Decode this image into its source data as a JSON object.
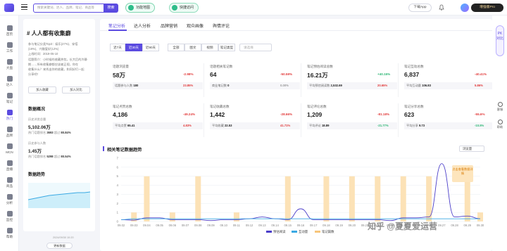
{
  "topbar": {
    "search_placeholder": "搜索关键词、达人、品牌、笔记、商品等",
    "search_button": "搜索",
    "pill1": "功能地图",
    "pill2": "快捷访问",
    "app_button": "下载App",
    "vip_label": "增强版Pro"
  },
  "sidenav": [
    {
      "label": "首页"
    },
    {
      "label": "工作"
    },
    {
      "label": "大盘"
    },
    {
      "label": "达人"
    },
    {
      "label": "笔记"
    },
    {
      "label": "热门"
    },
    {
      "label": "品牌"
    },
    {
      "label": "MCN"
    },
    {
      "label": "直播"
    },
    {
      "label": "商品"
    },
    {
      "label": "分析"
    },
    {
      "label": "监控"
    },
    {
      "label": "帮助"
    }
  ],
  "left": {
    "title": "# 人人都有收集癖",
    "meta1": "参与笔记分类Top3：娱乐(27%)、穿搭",
    "meta2": "(19%)、兴趣爱好(12%)",
    "meta3": "上线时间：2019-05-10",
    "meta4": "话题简介：小时候的收藏热忱，长大后的冷静",
    "meta5": "期……所有收集癖都应该被正视，你在",
    "meta6": "收集什么？来秀出你的收藏，和同好们一起",
    "meta7": "分享吧！",
    "btn1": "加入收藏",
    "btn2": "加入对比",
    "overview_h": "数据概况",
    "views_label": "历史浏览总量",
    "views_val": "5,102.06万",
    "views_rank_label": "热门话题排名",
    "views_rank": "3693",
    "views_beat_label": "超过",
    "views_beat": "80.84%",
    "part_label": "历史参与人数",
    "part_val": "1.45万",
    "part_rank_label": "热门话题排名",
    "part_rank": "5298",
    "part_beat_label": "超过",
    "part_beat": "80.54%",
    "trend_h": "数据趋势",
    "update_date": "2024/09/30 10:20",
    "update_btn": "更新数据"
  },
  "tabs": [
    "笔记分析",
    "达人分析",
    "品牌营销",
    "观众画像",
    "舆情评论"
  ],
  "ranges": [
    "近7天",
    "近30天",
    "近90天"
  ],
  "types": [
    "全部",
    "图文",
    "视频",
    "笔记类型"
  ],
  "select_placeholder": "请选择",
  "cards": [
    {
      "label": "话题浏览量",
      "value": "58万",
      "pct": "-2.98%",
      "pct_cls": "neg",
      "sub_label": "话题参与人数",
      "sub_value": "180",
      "sub_pct": "23.85%",
      "sub_cls": "neg"
    },
    {
      "label": "话题相关笔记数",
      "value": "64",
      "pct": "-50.59%",
      "pct_cls": "neg",
      "sub_label": "商业笔记数",
      "sub_value": "0",
      "sub_pct": "0.00%",
      "sub_cls": "gray"
    },
    {
      "label": "笔记预估阅读总数",
      "value": "16.21万",
      "pct": "+40.15%",
      "pct_cls": "pos",
      "sub_label": "平均预估阅读数",
      "sub_value": "2,532.69",
      "sub_pct": "20.65%",
      "sub_cls": "neg"
    },
    {
      "label": "笔记互动总数",
      "value": "6,837",
      "pct": "-40.41%",
      "pct_cls": "neg",
      "sub_label": "平均互动量",
      "sub_value": "106.83",
      "sub_pct": "5.86%",
      "sub_cls": "neg"
    },
    {
      "label": "笔记点赞总数",
      "value": "4,186",
      "pct": "-49.24%",
      "pct_cls": "neg",
      "sub_label": "平均点赞",
      "sub_value": "65.41",
      "sub_pct": "4.83%",
      "sub_cls": "neg"
    },
    {
      "label": "笔记收藏总数",
      "value": "1,442",
      "pct": "-28.66%",
      "pct_cls": "neg",
      "sub_label": "平均收藏",
      "sub_value": "22.53",
      "sub_pct": "41.71%",
      "sub_cls": "neg"
    },
    {
      "label": "笔记评论总数",
      "value": "1,209",
      "pct": "-81.18%",
      "pct_cls": "neg",
      "sub_label": "平均评论",
      "sub_value": "18.89",
      "sub_pct": "-21.77%",
      "sub_cls": "pos"
    },
    {
      "label": "笔记分享总数",
      "value": "623",
      "pct": "-55.6%",
      "pct_cls": "neg",
      "sub_label": "平均分享",
      "sub_value": "9.73",
      "sub_pct": "-10.5%",
      "sub_cls": "pos"
    }
  ],
  "chart_section": {
    "title": "相关笔记数据趋势",
    "select": "浏览量",
    "tag": "点击查看数据详情",
    "legend": [
      "预估阅读",
      "互动量",
      "笔记篇数"
    ]
  },
  "chart_data": {
    "type": "line",
    "categories": [
      "09.02",
      "09.03",
      "09.04",
      "09.05",
      "09.06",
      "09.07",
      "09.08",
      "09.09",
      "09.10",
      "09.11",
      "09.12",
      "09.13",
      "09.14",
      "09.15",
      "09.16",
      "09.17",
      "09.18",
      "09.19",
      "09.20",
      "09.21",
      "09.22",
      "09.23",
      "09.24",
      "09.25",
      "09.26",
      "09.27",
      "09.28",
      "09.29",
      "09.30"
    ],
    "series": [
      {
        "name": "笔记篇数",
        "kind": "bar",
        "values": [
          0,
          1,
          5,
          0,
          1,
          0,
          5,
          0,
          0,
          1,
          0,
          0,
          0,
          5,
          0,
          0,
          5,
          0,
          5,
          0,
          5,
          0,
          5,
          0,
          5,
          0,
          0,
          5,
          1
        ]
      },
      {
        "name": "预估阅读",
        "kind": "line",
        "values": [
          0.2,
          0.15,
          0.4,
          0.4,
          0.2,
          0.2,
          0.2,
          0.1,
          0.2,
          0.2,
          0.3,
          0.5,
          0.3,
          0.2,
          1.4,
          0.2,
          0.2,
          0.2,
          0.2,
          0.2,
          0.2,
          0.1,
          0.4,
          0.4,
          0.5,
          6.4,
          0.5,
          0.6,
          0.3
        ]
      },
      {
        "name": "互动量",
        "kind": "line",
        "values": [
          0.2,
          0.3,
          0.3,
          0.3,
          0.3,
          0.3,
          0.3,
          0.3,
          0.3,
          0.3,
          0.3,
          0.3,
          0.3,
          0.3,
          0.3,
          0.3,
          0.3,
          0.3,
          0.3,
          0.3,
          0.3,
          0.3,
          0.3,
          0.3,
          0.3,
          0.3,
          0.3,
          0.3,
          0.3
        ]
      }
    ],
    "y_ticks": [
      0,
      1,
      2,
      3,
      4,
      5,
      6,
      7
    ],
    "ylim": [
      0,
      7
    ]
  },
  "rightbar": {
    "pk": "PK 对比",
    "service": "客服",
    "help": "帮助"
  },
  "watermark": "知乎 @夏夏爱运营"
}
